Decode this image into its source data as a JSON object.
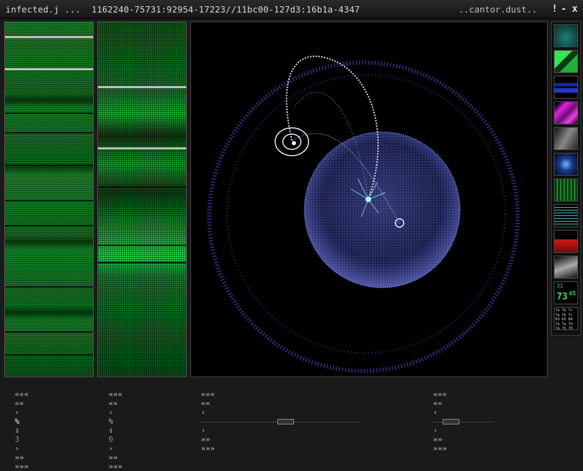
{
  "window": {
    "title": "infected.j ...  1162240-75731:92954-17223//11bc00-127d3:16b1a-4347",
    "title_right": "..cantor.dust..",
    "btn_help": "!",
    "btn_min": "-",
    "btn_close": "x"
  },
  "nav_left": {
    "first": "«««",
    "prev_page": "««",
    "prev": "‹",
    "zoom": "%",
    "stepper_value": "3",
    "next": "›",
    "next_page": "»»",
    "last": "»»»"
  },
  "nav_mid": {
    "first": "«««",
    "prev_page": "««",
    "prev": "‹",
    "zoom": "%",
    "stepper_value": "0",
    "next": "›",
    "next_page": "»»",
    "last": "»»»"
  },
  "nav_main_left": {
    "first": "«««",
    "prev_page": "««",
    "prev": "‹",
    "next": "›",
    "next_page": "»»",
    "last": "»»»"
  },
  "nav_main_right": {
    "first": "«««",
    "prev_page": "««",
    "prev": "‹",
    "next": "›",
    "next_page": "»»",
    "last": "»»»"
  },
  "thumbs": {
    "counter_small": "32",
    "counter_big": "73",
    "counter_sup": "65",
    "hex_grid": "7a 7b 7c\n7a 7b 7c\n83 65 84\n7a 7a 79\n7a 7b 79"
  },
  "colors": {
    "accent_green": "#2ee85a",
    "plot_blue": "#7a86ff",
    "background": "#000000"
  }
}
